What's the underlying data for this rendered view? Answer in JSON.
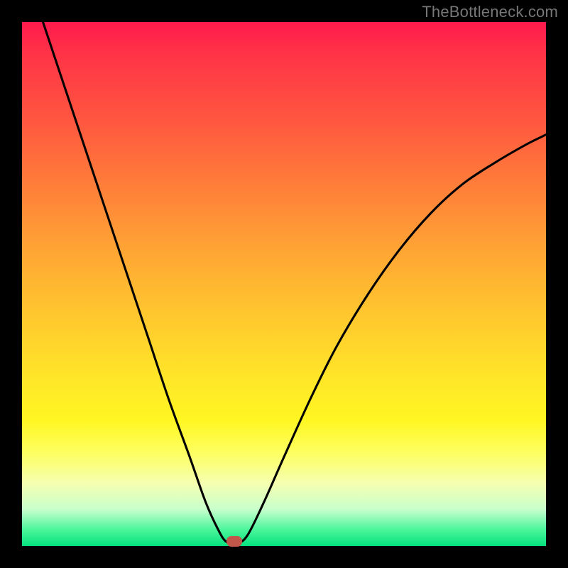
{
  "watermark": "TheBottleneck.com",
  "chart_data": {
    "type": "line",
    "title": "",
    "xlabel": "",
    "ylabel": "",
    "xlim": [
      0,
      100
    ],
    "ylim": [
      0,
      100
    ],
    "grid": false,
    "background_gradient": {
      "top": "#ff1a4d",
      "bottom": "#05e37e",
      "via": [
        "#ff7a3a",
        "#ffe628",
        "#fdff5e"
      ]
    },
    "series": [
      {
        "name": "curve",
        "color": "#000000",
        "points": [
          {
            "x": 4.0,
            "y": 100.0
          },
          {
            "x": 8.0,
            "y": 88.0
          },
          {
            "x": 12.0,
            "y": 76.0
          },
          {
            "x": 16.0,
            "y": 64.0
          },
          {
            "x": 20.0,
            "y": 52.0
          },
          {
            "x": 24.0,
            "y": 40.0
          },
          {
            "x": 28.0,
            "y": 28.0
          },
          {
            "x": 32.0,
            "y": 17.0
          },
          {
            "x": 35.0,
            "y": 8.5
          },
          {
            "x": 37.5,
            "y": 3.0
          },
          {
            "x": 39.0,
            "y": 0.8
          },
          {
            "x": 41.0,
            "y": 0.5
          },
          {
            "x": 43.0,
            "y": 2.0
          },
          {
            "x": 46.0,
            "y": 8.0
          },
          {
            "x": 50.0,
            "y": 17.0
          },
          {
            "x": 55.0,
            "y": 28.0
          },
          {
            "x": 60.0,
            "y": 38.0
          },
          {
            "x": 66.0,
            "y": 48.0
          },
          {
            "x": 72.0,
            "y": 56.5
          },
          {
            "x": 78.0,
            "y": 63.5
          },
          {
            "x": 84.0,
            "y": 69.0
          },
          {
            "x": 90.0,
            "y": 73.0
          },
          {
            "x": 96.0,
            "y": 76.5
          },
          {
            "x": 100.0,
            "y": 78.5
          }
        ]
      }
    ],
    "marker": {
      "x": 40.5,
      "y": 0.8,
      "color": "#c1564a"
    }
  }
}
